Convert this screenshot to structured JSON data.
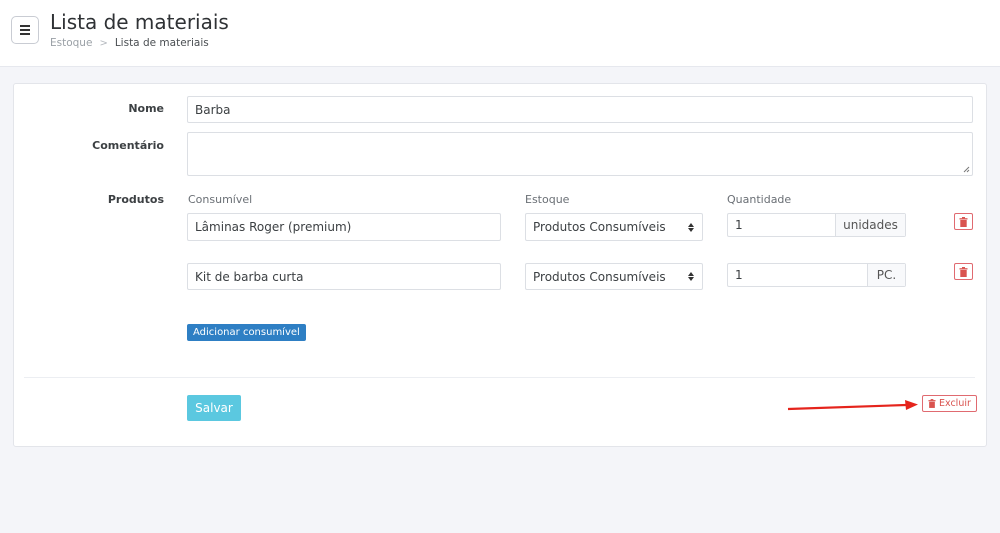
{
  "header": {
    "title": "Lista de materiais",
    "breadcrumb": {
      "parent": "Estoque",
      "separator": ">",
      "current": "Lista de materiais"
    }
  },
  "form": {
    "name_label": "Nome",
    "name_value": "Barba",
    "comment_label": "Comentário",
    "comment_value": "",
    "products_label": "Produtos",
    "columns": {
      "consumable": "Consumível",
      "stock": "Estoque",
      "quantity": "Quantidade"
    },
    "rows": [
      {
        "consumable": "Lâminas Roger (premium)",
        "stock": "Produtos Consumíveis",
        "quantity": "1",
        "unit": "unidades"
      },
      {
        "consumable": "Kit de barba curta",
        "stock": "Produtos Consumíveis",
        "quantity": "1",
        "unit": "PC."
      }
    ],
    "add_label": "Adicionar consumível",
    "save_label": "Salvar",
    "delete_label": "Excluir"
  },
  "colors": {
    "primary": "#2e7fc4",
    "info": "#5bc8e0",
    "danger": "#d9534f",
    "annotation_arrow": "#e5241c"
  }
}
